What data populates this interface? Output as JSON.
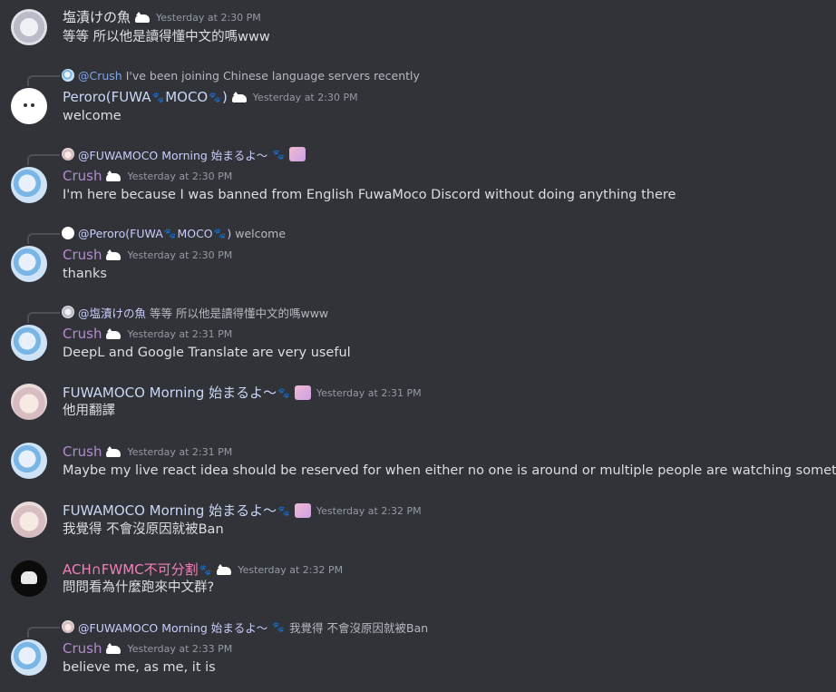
{
  "messages": [
    {
      "author": "塩漬けの魚",
      "time": "Yesterday at 2:30 PM",
      "text": "等等 所以他是讀得懂中文的嗎www"
    },
    {
      "reply": {
        "mention": "@Crush",
        "text": "I've been joining Chinese language servers recently"
      },
      "author_parts": [
        "Peroro(FUWA",
        "MOCO",
        ")"
      ],
      "time": "Yesterday at 2:30 PM",
      "text": "welcome"
    },
    {
      "reply": {
        "mention": "@FUWAMOCO Morning 始まるよ〜",
        "text": ""
      },
      "author": "Crush",
      "time": "Yesterday at 2:30 PM",
      "text": "I'm here because I was banned from English FuwaMoco Discord without doing anything there"
    },
    {
      "reply": {
        "mention_parts": [
          "@Peroro(FUWA",
          "MOCO",
          ")"
        ],
        "text": "welcome"
      },
      "author": "Crush",
      "time": "Yesterday at 2:30 PM",
      "text": "thanks"
    },
    {
      "reply": {
        "mention": "@塩漬けの魚",
        "text": "等等 所以他是讀得懂中文的嗎www"
      },
      "author": "Crush",
      "time": "Yesterday at 2:31 PM",
      "text": "DeepL and Google Translate are very useful"
    },
    {
      "author": "FUWAMOCO Morning 始まるよ〜",
      "time": "Yesterday at 2:31 PM",
      "text": "他用翻譯"
    },
    {
      "author": "Crush",
      "time": "Yesterday at 2:31 PM",
      "text": "Maybe my live react idea should be reserved for when either no one is around or multiple people are watching something"
    },
    {
      "author": "FUWAMOCO Morning 始まるよ〜",
      "time": "Yesterday at 2:32 PM",
      "text": "我覺得 不會沒原因就被Ban"
    },
    {
      "author": "ACH∩FWMC不可分割",
      "time": "Yesterday at 2:32 PM",
      "text": "問問看為什麼跑來中文群?"
    },
    {
      "reply": {
        "mention": "@FUWAMOCO Morning 始まるよ〜",
        "text": "我覺得 不會沒原因就被Ban"
      },
      "author": "Crush",
      "time": "Yesterday at 2:33 PM",
      "text": "believe me, as me, it is"
    }
  ],
  "icons": {
    "paw": "🐾",
    "cat_badge": "cat-badge-icon"
  },
  "colors": {
    "background": "#313338",
    "crush": "#b38bd0",
    "fuwamoco": "#c9d7f5",
    "ach": "#f47fb8",
    "timestamp": "#949ba4",
    "text": "#dbdee1"
  }
}
